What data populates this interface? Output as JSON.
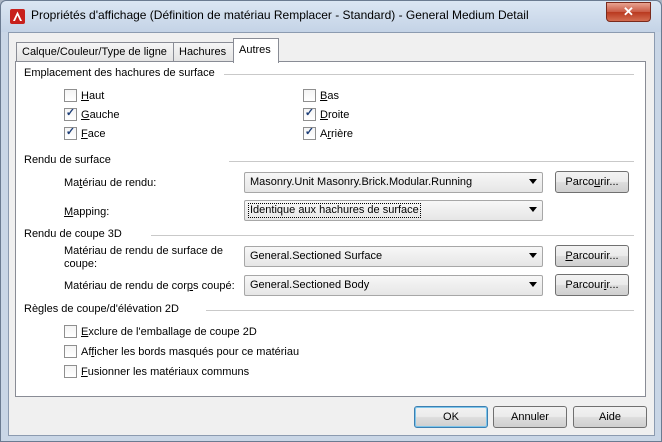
{
  "window": {
    "title": "Propriétés d'affichage (Définition de matériau Remplacer - Standard) - General Medium Detail",
    "close_glyph": "✕",
    "app_icon": "autocad-a-icon"
  },
  "tabs": [
    {
      "label": "Calque/Couleur/Type de ligne",
      "active": false
    },
    {
      "label": "Hachures",
      "active": false
    },
    {
      "label": "Autres",
      "active": true
    }
  ],
  "hatch_placement": {
    "title": "Emplacement des hachures de surface",
    "options": [
      {
        "key": "H",
        "rest": "aut",
        "checked": false
      },
      {
        "key": "B",
        "rest": "as",
        "checked": false
      },
      {
        "key": "G",
        "rest": "auche",
        "checked": true
      },
      {
        "key": "D",
        "rest": "roite",
        "checked": true
      },
      {
        "key": "F",
        "rest": "ace",
        "checked": true
      },
      {
        "pre": "A",
        "key": "r",
        "rest": "rière",
        "checked": true
      }
    ]
  },
  "surface_rendering": {
    "title": "Rendu de surface",
    "render_material": {
      "pre": "Ma",
      "key": "t",
      "rest": "ériau de rendu:",
      "value": "Masonry.Unit Masonry.Brick.Modular.Running",
      "browse_pre": "Parco",
      "browse_key": "u",
      "browse_rest": "rir..."
    },
    "mapping": {
      "key": "M",
      "rest": "apping:",
      "value": "Identique aux hachures de surface"
    }
  },
  "section_3d": {
    "title": "Rendu de coupe 3D",
    "surface_material": {
      "line1": "Matériau de rendu de surface de",
      "line2": "coupe:",
      "value": "General.Sectioned Surface",
      "browse_key": "P",
      "browse_rest": "arcourir..."
    },
    "body_material": {
      "pre": "Matériau de rendu de cor",
      "key": "p",
      "rest": "s coupé:",
      "value": "General.Sectioned Body",
      "browse_pre": "Parcour",
      "browse_key": "i",
      "browse_rest": "r..."
    }
  },
  "section_2d": {
    "title": "Règles de coupe/d'élévation 2D",
    "options": [
      {
        "pre": "",
        "key": "E",
        "rest": "xclure de l'emballage de coupe 2D",
        "checked": false
      },
      {
        "pre": "Af",
        "key": "f",
        "rest": "icher les bords masqués pour ce matériau",
        "checked": false
      },
      {
        "pre": "",
        "key": "F",
        "rest": "usionner les matériaux communs",
        "checked": false
      }
    ]
  },
  "buttons": {
    "ok": "OK",
    "cancel": "Annuler",
    "help": "Aide"
  },
  "check_glyph": "✓"
}
